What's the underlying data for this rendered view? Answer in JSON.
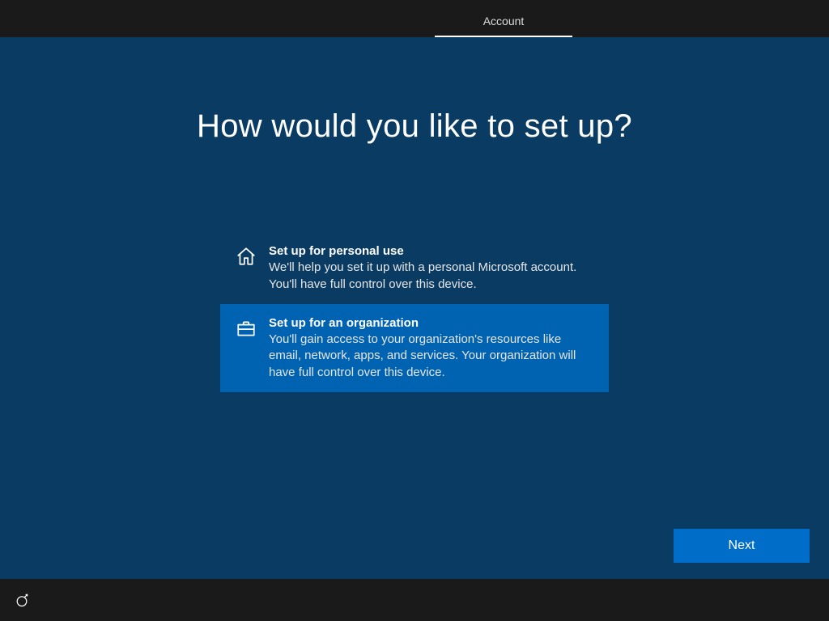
{
  "header": {
    "tab_label": "Account"
  },
  "main": {
    "heading": "How would you like to set up?",
    "options": [
      {
        "title": "Set up for personal use",
        "desc": "We'll help you set it up with a personal Microsoft account. You'll have full control over this device."
      },
      {
        "title": "Set up for an organization",
        "desc": "You'll gain access to your organization's resources like email, network, apps, and services. Your organization will have full control over this device."
      }
    ],
    "next_label": "Next"
  }
}
